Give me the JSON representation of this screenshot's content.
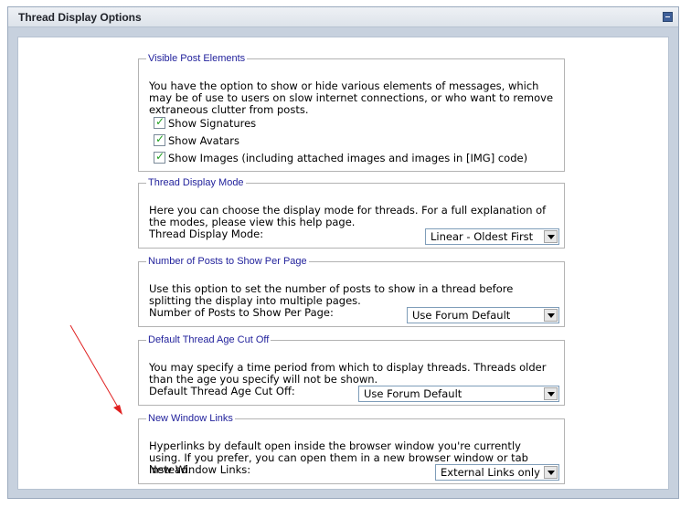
{
  "panel": {
    "title": "Thread Display Options"
  },
  "visible_post": {
    "legend": "Visible Post Elements",
    "description": "You have the option to show or hide various elements of messages, which may be of use to users on slow internet connections, or who want to remove extraneous clutter from posts.",
    "checkboxes": [
      {
        "label": "Show Signatures",
        "checked": true
      },
      {
        "label": "Show Avatars",
        "checked": true
      },
      {
        "label": "Show Images (including attached images and images in [IMG] code)",
        "checked": true
      }
    ]
  },
  "display_mode": {
    "legend": "Thread Display Mode",
    "description": "Here you can choose the display mode for threads. For a full explanation of the modes, please view this help page.",
    "field_label": "Thread Display Mode:",
    "selected": "Linear - Oldest First"
  },
  "posts_per_page": {
    "legend": "Number of Posts to Show Per Page",
    "description": "Use this option to set the number of posts to show in a thread before splitting the display into multiple pages.",
    "field_label": "Number of Posts to Show Per Page:",
    "selected": "Use Forum Default"
  },
  "age_cutoff": {
    "legend": "Default Thread Age Cut Off",
    "description": "You may specify a time period from which to display threads. Threads older than the age you specify will not be shown.",
    "field_label": "Default Thread Age Cut Off:",
    "selected": "Use Forum Default"
  },
  "new_window": {
    "legend": "New Window Links",
    "description": "Hyperlinks by default open inside the browser window you're currently using. If you prefer, you can open them in a new browser window or tab instead.",
    "field_label": "New Window Links:",
    "selected": "External Links only"
  },
  "annotation": {
    "color": "#e02020",
    "icon": "red-arrow-annotation"
  },
  "theme": {
    "legend_color": "#22229c",
    "panel_bg": "#c7d1de",
    "checkmark": "#21a121"
  }
}
